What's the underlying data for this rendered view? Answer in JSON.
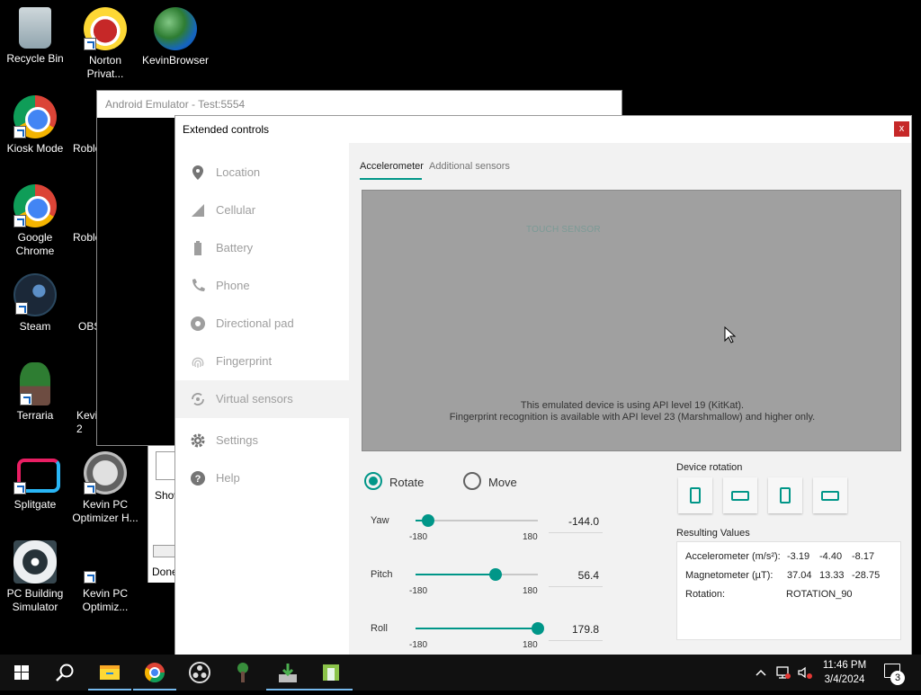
{
  "desktop": {
    "icons": [
      {
        "label": "Recycle Bin",
        "icon": "recycle-bin-icon"
      },
      {
        "label": "Norton Privat...",
        "icon": "norton-icon"
      },
      {
        "label": "KevinBrowser",
        "icon": "globe-icon"
      },
      {
        "label": "Kiosk Mode",
        "icon": "chrome-icon"
      },
      {
        "label": "Roblo",
        "icon": "roblox-icon"
      },
      {
        "label": "Google Chrome",
        "icon": "chrome-icon"
      },
      {
        "label": "Roblo",
        "icon": "roblox-icon"
      },
      {
        "label": "Steam",
        "icon": "steam-icon"
      },
      {
        "label": "OBS",
        "icon": "obs-icon"
      },
      {
        "label": "Terraria",
        "icon": "terraria-icon"
      },
      {
        "label": "Kevi 2",
        "icon": "app-icon"
      },
      {
        "label": "Splitgate",
        "icon": "splitgate-icon"
      },
      {
        "label": "Kevin PC Optimizer H...",
        "icon": "gauge-icon"
      },
      {
        "label": "PC Building Simulator",
        "icon": "pc-building-icon"
      },
      {
        "label": "Kevin PC Optimiz...",
        "icon": "shortcut-icon"
      }
    ]
  },
  "emulator": {
    "title": "Android Emulator - Test:5554"
  },
  "behind_window": {
    "text1": "Show",
    "text2": "Done"
  },
  "extended": {
    "title": "Extended controls",
    "close_glyph": "x",
    "nav": [
      {
        "label": "Location",
        "icon": "location-pin-icon"
      },
      {
        "label": "Cellular",
        "icon": "signal-icon"
      },
      {
        "label": "Battery",
        "icon": "battery-icon"
      },
      {
        "label": "Phone",
        "icon": "phone-icon"
      },
      {
        "label": "Directional pad",
        "icon": "dpad-icon"
      },
      {
        "label": "Fingerprint",
        "icon": "fingerprint-icon"
      },
      {
        "label": "Virtual sensors",
        "icon": "rotation-icon",
        "active": true
      },
      {
        "label": "Settings",
        "icon": "gear-icon"
      },
      {
        "label": "Help",
        "icon": "help-icon"
      }
    ],
    "tabs": {
      "accelerometer": "Accelerometer",
      "additional": "Additional sensors"
    },
    "touch_sensor": "TOUCH SENSOR",
    "message1": "This emulated device is using API level 19 (KitKat).",
    "message2": "Fingerprint recognition is available with API level 23 (Marshmallow) and higher only.",
    "mode": {
      "rotate": "Rotate",
      "move": "Move",
      "selected": "rotate"
    },
    "sliders": [
      {
        "label": "Yaw",
        "min": "-180",
        "max": "180",
        "value": "-144.0",
        "num": -144.0
      },
      {
        "label": "Pitch",
        "min": "-180",
        "max": "180",
        "value": "56.4",
        "num": 56.4
      },
      {
        "label": "Roll",
        "min": "-180",
        "max": "180",
        "value": "179.8",
        "num": 179.8
      }
    ],
    "device_rotation_label": "Device rotation",
    "resulting_label": "Resulting Values",
    "results": {
      "accel_label": "Accelerometer (m/s²):",
      "accel": [
        "-3.19",
        "-4.40",
        "-8.17"
      ],
      "mag_label": "Magnetometer (µT):",
      "mag": [
        "37.04",
        "13.33",
        "-28.75"
      ],
      "rot_label": "Rotation:",
      "rot": "ROTATION_90"
    },
    "accent_color": "#009688"
  },
  "taskbar": {
    "time": "11:46 PM",
    "date": "3/4/2024",
    "notifications": "3"
  }
}
